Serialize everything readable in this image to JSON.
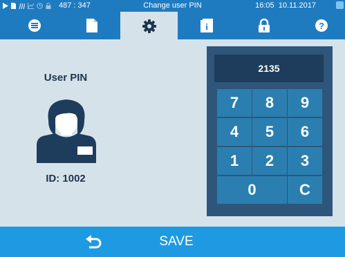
{
  "status_bar": {
    "coordinates": "487 : 347",
    "title": "Change user PIN",
    "time": "16:05",
    "date": "10.11.2017",
    "icons": [
      "play-icon",
      "document-icon",
      "signal-icon",
      "chart-icon",
      "clock-icon",
      "lock-icon"
    ]
  },
  "tabs": [
    {
      "name": "menu",
      "icon": "list-icon",
      "active": false
    },
    {
      "name": "documents",
      "icon": "document-icon",
      "active": false
    },
    {
      "name": "settings",
      "icon": "gear-icon",
      "active": true
    },
    {
      "name": "info",
      "icon": "info-book-icon",
      "active": false
    },
    {
      "name": "lock",
      "icon": "padlock-icon",
      "active": false
    },
    {
      "name": "help",
      "icon": "question-icon",
      "active": false
    }
  ],
  "user": {
    "title": "User PIN",
    "id_label": "ID: 1002"
  },
  "keypad": {
    "display": "2135",
    "keys": [
      "7",
      "8",
      "9",
      "4",
      "5",
      "6",
      "1",
      "2",
      "3",
      "0",
      "C"
    ]
  },
  "bottom_bar": {
    "save_label": "SAVE",
    "back_icon": "back-arrow-icon"
  },
  "colors": {
    "primary": "#1f7bc0",
    "bottom_bar": "#1e9ae3",
    "background": "#d6e2ea",
    "keypad_frame": "#2e567a",
    "key": "#2a7fb0",
    "text_dark": "#1e3450"
  }
}
